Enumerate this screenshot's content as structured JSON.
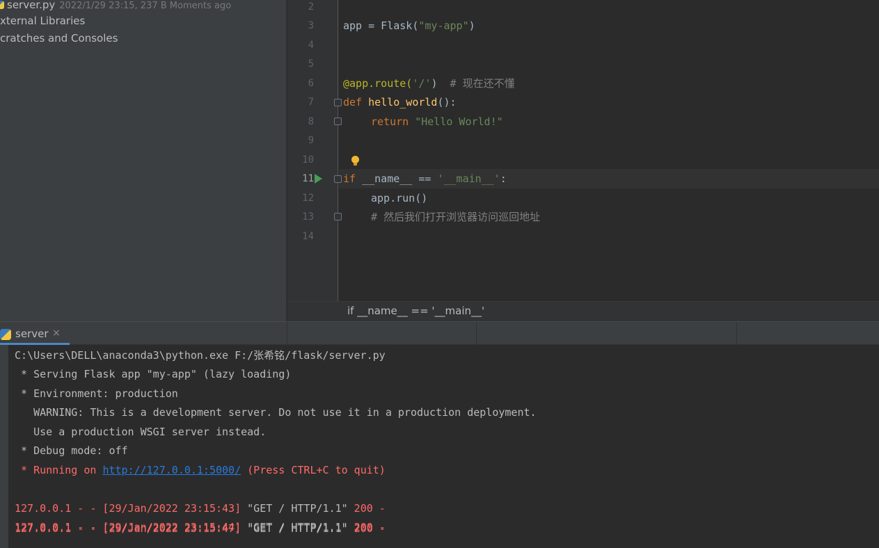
{
  "project_tree": {
    "items": [
      {
        "name": "server.py",
        "meta": "2022/1/29 23:15, 237 B Moments ago"
      },
      {
        "name": "xternal Libraries"
      },
      {
        "name": "cratches and Consoles"
      }
    ]
  },
  "editor": {
    "current_line": "11",
    "line_numbers": [
      "2",
      "3",
      "4",
      "5",
      "6",
      "7",
      "8",
      "9",
      "10",
      "11",
      "12",
      "13",
      "14"
    ],
    "code": {
      "l3_app": "app = Flask(",
      "l3_str": "\"my-app\"",
      "l3_end": ")",
      "l6_dec": "@app.route(",
      "l6_str": "'/'",
      "l6_mid": ")  ",
      "l6_cm": "# 现在还不懂",
      "l7_kw": "def ",
      "l7_fn": "hello_world",
      "l7_end": "():",
      "l8_kw": "return ",
      "l8_str": "\"Hello World!\"",
      "l11_kw": "if ",
      "l11_mid": "__name__ == ",
      "l11_str": "'__main__'",
      "l11_end": ":",
      "l12": "app.run()",
      "l13_cm": "# 然后我们打开浏览器访问巡回地址"
    },
    "breadcrumb": "if __name__ == '__main__'"
  },
  "run_panel": {
    "tab_label": "server",
    "tab_close": "×",
    "console": {
      "cmd": "C:\\Users\\DELL\\anaconda3\\python.exe F:/张希铭/flask/server.py",
      "l1": " * Serving Flask app \"my-app\" (lazy loading)",
      "l2": " * Environment: production",
      "l3": "   WARNING: This is a development server. Do not use it in a production deployment.",
      "l4": "   Use a production WSGI server instead.",
      "l5": " * Debug mode: off",
      "running_pre": " * Running on ",
      "running_link": "http://127.0.0.1:5000/",
      "running_post": " (Press CTRL+C to quit)",
      "req1": "127.0.0.1 - - [29/Jan/2022 23:15:43] ",
      "req1_get": "\"GET / HTTP/1.1\"",
      "req1_tail": " 200 -",
      "req2": "127.0.0.1 - - [29/Jan/2022 23:15:44] ",
      "req2_get": "\"GET / HTTP/1.1\"",
      "req2_tail": " 200 -",
      "req3": "127.0.0.1 - - [29/Jan/2022 23:15:47] ",
      "req3_get": "\"GET / HTTP/1.1\"",
      "req3_tail": " 200 -"
    }
  },
  "icons": {
    "python_file": "python-file-icon",
    "run": "run-gutter-icon",
    "bulb": "intention-bulb-icon",
    "fold": "fold-marker-icon"
  },
  "colors": {
    "keyword": "#cc7832",
    "string": "#6a8759",
    "decorator": "#bbb529",
    "function": "#ffc66d",
    "comment": "#808080",
    "error_output": "#ff6b68",
    "link": "#287bde",
    "run_green": "#499c54",
    "tab_underline": "#4a88c7"
  }
}
